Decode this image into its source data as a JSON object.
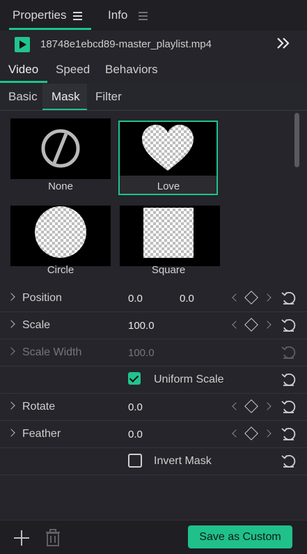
{
  "top_tabs": [
    {
      "label": "Properties",
      "active": true
    },
    {
      "label": "Info",
      "active": false
    }
  ],
  "file": {
    "name": "18748e1ebcd89-master_playlist.mp4",
    "icon": "play-icon"
  },
  "section_tabs": [
    "Video",
    "Speed",
    "Behaviors"
  ],
  "sub_tabs": [
    "Basic",
    "Mask",
    "Filter"
  ],
  "masks": [
    {
      "label": "None",
      "selected": false
    },
    {
      "label": "Love",
      "selected": true
    },
    {
      "label": "Circle",
      "selected": false
    },
    {
      "label": "Square",
      "selected": false
    }
  ],
  "properties": {
    "position": {
      "label": "Position",
      "x": "0.0",
      "y": "0.0"
    },
    "scale": {
      "label": "Scale",
      "value": "100.0"
    },
    "scale_width": {
      "label": "Scale Width",
      "value": "100.0"
    },
    "uniform_scale": {
      "label": "Uniform Scale",
      "checked": true
    },
    "rotate": {
      "label": "Rotate",
      "value": "0.0"
    },
    "feather": {
      "label": "Feather",
      "value": "0.0"
    },
    "invert_mask": {
      "label": "Invert Mask",
      "checked": false
    }
  },
  "footer": {
    "save_label": "Save as Custom"
  },
  "colors": {
    "accent": "#1fc28c",
    "background": "#25252b"
  }
}
